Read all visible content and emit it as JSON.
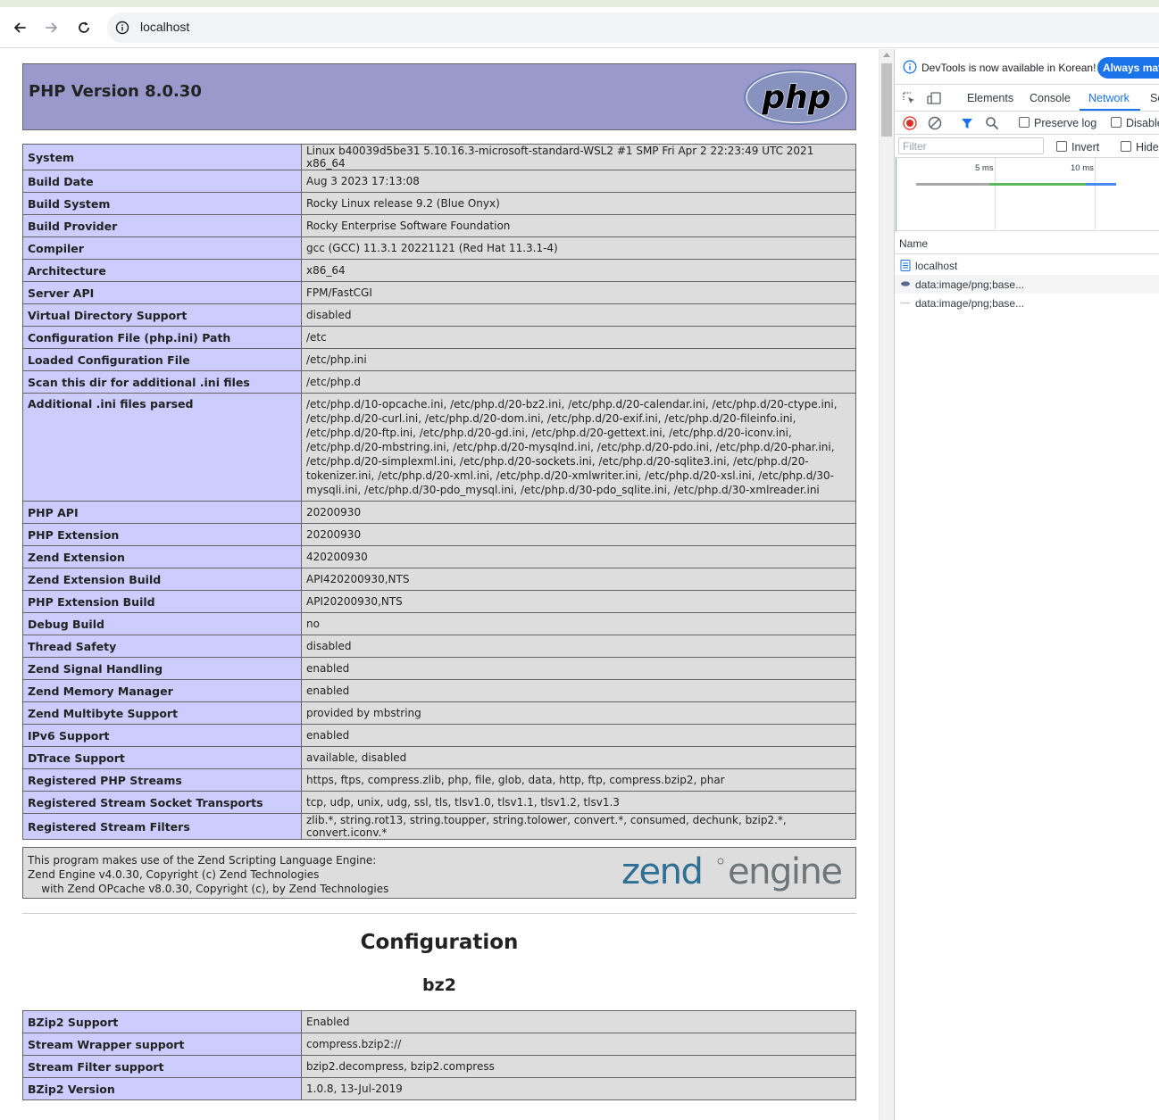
{
  "browser": {
    "url": "localhost",
    "back_icon": "arrow-left-icon",
    "forward_icon": "arrow-right-icon",
    "reload_icon": "reload-icon",
    "site_info_icon": "info-circle-icon"
  },
  "phpinfo": {
    "title": "PHP Version 8.0.30",
    "logo_text": "php",
    "general": [
      {
        "k": "System",
        "v": "Linux b40039d5be31 5.10.16.3-microsoft-standard-WSL2 #1 SMP Fri Apr 2 22:23:49 UTC 2021 x86_64"
      },
      {
        "k": "Build Date",
        "v": "Aug 3 2023 17:13:08"
      },
      {
        "k": "Build System",
        "v": "Rocky Linux release 9.2 (Blue Onyx)"
      },
      {
        "k": "Build Provider",
        "v": "Rocky Enterprise Software Foundation"
      },
      {
        "k": "Compiler",
        "v": "gcc (GCC) 11.3.1 20221121 (Red Hat 11.3.1-4)"
      },
      {
        "k": "Architecture",
        "v": "x86_64"
      },
      {
        "k": "Server API",
        "v": "FPM/FastCGI"
      },
      {
        "k": "Virtual Directory Support",
        "v": "disabled"
      },
      {
        "k": "Configuration File (php.ini) Path",
        "v": "/etc"
      },
      {
        "k": "Loaded Configuration File",
        "v": "/etc/php.ini"
      },
      {
        "k": "Scan this dir for additional .ini files",
        "v": "/etc/php.d"
      },
      {
        "k": "Additional .ini files parsed",
        "v": "/etc/php.d/10-opcache.ini, /etc/php.d/20-bz2.ini, /etc/php.d/20-calendar.ini, /etc/php.d/20-ctype.ini, /etc/php.d/20-curl.ini, /etc/php.d/20-dom.ini, /etc/php.d/20-exif.ini, /etc/php.d/20-fileinfo.ini, /etc/php.d/20-ftp.ini, /etc/php.d/20-gd.ini, /etc/php.d/20-gettext.ini, /etc/php.d/20-iconv.ini, /etc/php.d/20-mbstring.ini, /etc/php.d/20-mysqlnd.ini, /etc/php.d/20-pdo.ini, /etc/php.d/20-phar.ini, /etc/php.d/20-simplexml.ini, /etc/php.d/20-sockets.ini, /etc/php.d/20-sqlite3.ini, /etc/php.d/20-tokenizer.ini, /etc/php.d/20-xml.ini, /etc/php.d/20-xmlwriter.ini, /etc/php.d/20-xsl.ini, /etc/php.d/30-mysqli.ini, /etc/php.d/30-pdo_mysql.ini, /etc/php.d/30-pdo_sqlite.ini, /etc/php.d/30-xmlreader.ini",
        "tall": true
      },
      {
        "k": "PHP API",
        "v": "20200930"
      },
      {
        "k": "PHP Extension",
        "v": "20200930"
      },
      {
        "k": "Zend Extension",
        "v": "420200930"
      },
      {
        "k": "Zend Extension Build",
        "v": "API420200930,NTS"
      },
      {
        "k": "PHP Extension Build",
        "v": "API20200930,NTS"
      },
      {
        "k": "Debug Build",
        "v": "no"
      },
      {
        "k": "Thread Safety",
        "v": "disabled"
      },
      {
        "k": "Zend Signal Handling",
        "v": "enabled"
      },
      {
        "k": "Zend Memory Manager",
        "v": "enabled"
      },
      {
        "k": "Zend Multibyte Support",
        "v": "provided by mbstring"
      },
      {
        "k": "IPv6 Support",
        "v": "enabled"
      },
      {
        "k": "DTrace Support",
        "v": "available, disabled"
      },
      {
        "k": "Registered PHP Streams",
        "v": "https, ftps, compress.zlib, php, file, glob, data, http, ftp, compress.bzip2, phar"
      },
      {
        "k": "Registered Stream Socket Transports",
        "v": "tcp, udp, unix, udg, ssl, tls, tlsv1.0, tlsv1.1, tlsv1.2, tlsv1.3"
      },
      {
        "k": "Registered Stream Filters",
        "v": "zlib.*, string.rot13, string.toupper, string.tolower, convert.*, consumed, dechunk, bzip2.*, convert.iconv.*"
      }
    ],
    "zend": {
      "line1": "This program makes use of the Zend Scripting Language Engine:",
      "line2": "Zend Engine v4.0.30, Copyright (c) Zend Technologies",
      "line3": "    with Zend OPcache v8.0.30, Copyright (c), by Zend Technologies",
      "logo_word1": "zend",
      "logo_word2": "engine"
    },
    "config_heading": "Configuration",
    "bz2_heading": "bz2",
    "bz2": [
      {
        "k": "BZip2 Support",
        "v": "Enabled"
      },
      {
        "k": "Stream Wrapper support",
        "v": "compress.bzip2://"
      },
      {
        "k": "Stream Filter support",
        "v": "bzip2.decompress, bzip2.compress"
      },
      {
        "k": "BZip2 Version",
        "v": "1.0.8, 13-Jul-2019"
      }
    ]
  },
  "devtools": {
    "banner_text": "DevTools is now available in Korean!",
    "banner_button": "Always match",
    "tabs": [
      "Elements",
      "Console",
      "Network",
      "So"
    ],
    "active_tab": "Network",
    "preserve_log": "Preserve log",
    "disable_cache": "Disable",
    "filter_placeholder": "Filter",
    "invert": "Invert",
    "hide": "Hide",
    "ticks": [
      "5 ms",
      "10 ms"
    ],
    "name_header": "Name",
    "requests": [
      "localhost",
      "data:image/png;base...",
      "data:image/png;base..."
    ],
    "colors": {
      "accent": "#1a73e8",
      "record": "#d93025"
    }
  }
}
